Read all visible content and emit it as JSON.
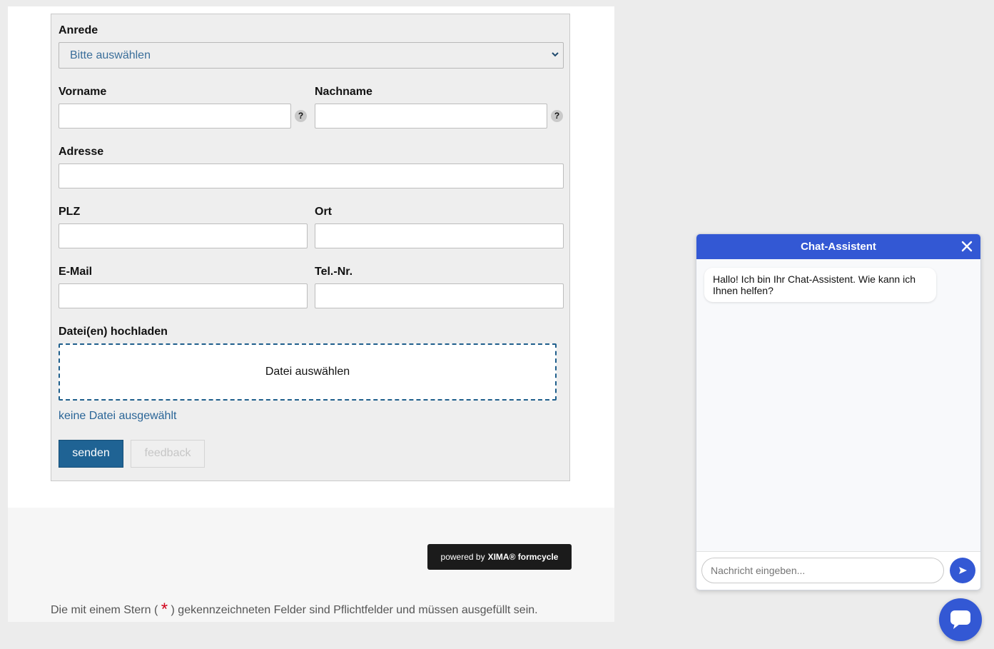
{
  "form": {
    "salutation": {
      "label": "Anrede",
      "selected": "Bitte auswählen"
    },
    "firstname": {
      "label": "Vorname",
      "value": "",
      "help": "?"
    },
    "lastname": {
      "label": "Nachname",
      "value": "",
      "help": "?"
    },
    "address": {
      "label": "Adresse",
      "value": ""
    },
    "zip": {
      "label": "PLZ",
      "value": ""
    },
    "city": {
      "label": "Ort",
      "value": ""
    },
    "email": {
      "label": "E-Mail",
      "value": ""
    },
    "phone": {
      "label": "Tel.-Nr.",
      "value": ""
    },
    "upload": {
      "label": "Datei(en) hochladen",
      "button": "Datei auswählen",
      "status": "keine Datei ausgewählt"
    },
    "buttons": {
      "send": "senden",
      "feedback": "feedback"
    }
  },
  "footer": {
    "powered_prefix": "powered by",
    "powered_brand": "XIMA® formcycle",
    "required_note_before": "Die mit einem Stern (",
    "required_star": "*",
    "required_note_after": ") gekennzeichneten Felder sind Pflichtfelder und müssen ausgefüllt sein."
  },
  "chat": {
    "title": "Chat-Assistent",
    "messages": [
      {
        "from": "bot",
        "text": "Hallo! Ich bin Ihr Chat-Assistent. Wie kann ich Ihnen helfen?"
      }
    ],
    "input_placeholder": "Nachricht eingeben...",
    "send_icon": "send-icon",
    "close_icon": "close-icon",
    "fab_icon": "chat-bubble-icon"
  },
  "colors": {
    "primary_blue": "#1f6394",
    "chat_blue": "#3358d4",
    "link_blue": "#2a6597",
    "required_red": "#d0021b"
  }
}
